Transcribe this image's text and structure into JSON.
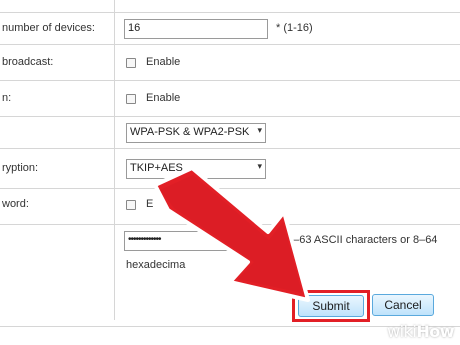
{
  "form": {
    "rows": [
      {
        "label": "number of devices:",
        "value": "16",
        "hint": "*   (1-16)"
      },
      {
        "label": "broadcast:",
        "checkbox_label": "Enable"
      },
      {
        "label": "n:",
        "checkbox_label": "Enable"
      },
      {
        "label": "",
        "select_value": "WPA-PSK & WPA2-PSK"
      },
      {
        "label": "ryption:",
        "select_value": "TKIP+AES"
      },
      {
        "label": "word:",
        "checkbox_label": "E"
      },
      {
        "label": "",
        "password_value": "•••••••••••••",
        "hint": "*   (8–63 ASCII characters or 8–64",
        "hint2": "hexadecima"
      }
    ]
  },
  "buttons": {
    "submit_label": "Submit",
    "cancel_label": "Cancel"
  },
  "watermark": {
    "wiki": "wiki",
    "how": "How"
  },
  "colors": {
    "highlight_red": "#e21f26",
    "button_border": "#5aa9dd",
    "divider": "#d6d6d6"
  },
  "icons": {
    "select_arrow": "chevron-down-icon",
    "annotation_arrow": "red-arrow-icon"
  }
}
